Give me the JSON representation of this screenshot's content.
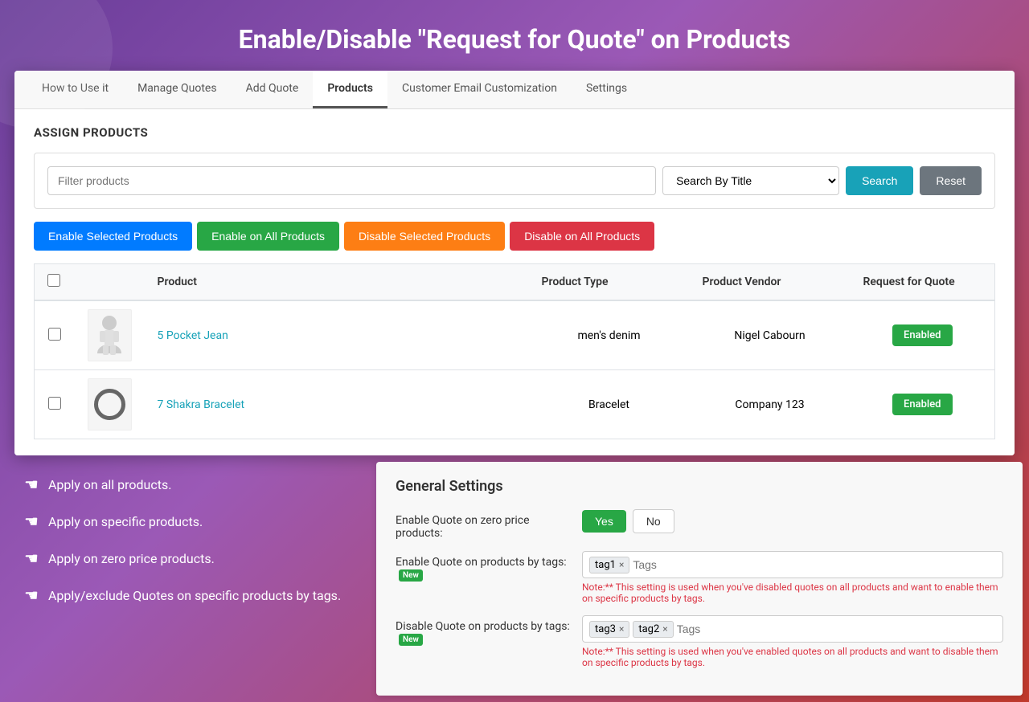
{
  "page": {
    "title": "Enable/Disable \"Request for Quote\" on Products",
    "background": "linear-gradient(135deg, #6a3d9a 0%, #9b59b6 40%, #c0392b 100%)"
  },
  "tabs": [
    {
      "label": "How to Use it",
      "active": false
    },
    {
      "label": "Manage Quotes",
      "active": false
    },
    {
      "label": "Add Quote",
      "active": false
    },
    {
      "label": "Products",
      "active": true
    },
    {
      "label": "Customer Email Customization",
      "active": false
    },
    {
      "label": "Settings",
      "active": false
    }
  ],
  "section": {
    "title": "ASSIGN PRODUCTS"
  },
  "filter": {
    "placeholder": "Filter products",
    "select_default": "Search By Title",
    "search_label": "Search",
    "reset_label": "Reset"
  },
  "action_buttons": {
    "enable_selected": "Enable Selected Products",
    "enable_all": "Enable on All Products",
    "disable_selected": "Disable Selected Products",
    "disable_all": "Disable on All Products"
  },
  "table": {
    "headers": [
      "",
      "",
      "Product",
      "Product Type",
      "Product Vendor",
      "Request for Quote"
    ],
    "rows": [
      {
        "id": 1,
        "product_name": "5 Pocket Jean",
        "product_type": "men's denim",
        "vendor": "Nigel Cabourn",
        "rfq_status": "Enabled",
        "img_type": "person"
      },
      {
        "id": 2,
        "product_name": "7 Shakra Bracelet",
        "product_type": "Bracelet",
        "vendor": "Company 123",
        "rfq_status": "Enabled",
        "img_type": "bracelet"
      }
    ]
  },
  "left_panel": {
    "items": [
      "Apply on all products.",
      "Apply on specific products.",
      "Apply on zero price products.",
      "Apply/exclude Quotes on specific products by tags."
    ]
  },
  "general_settings": {
    "title": "General Settings",
    "zero_price_label": "Enable Quote on zero price products:",
    "zero_price_yes": "Yes",
    "zero_price_no": "No",
    "tags_enable_label": "Enable Quote on products by tags:",
    "tags_enable_new": "New",
    "tags_enable_chips": [
      "tag1"
    ],
    "tags_enable_placeholder": "Tags",
    "tags_enable_note": "Note:** This setting is used when you've disabled quotes on all products and want to enable them on specific products by tags.",
    "tags_disable_label": "Disable Quote on products by tags:",
    "tags_disable_new": "New",
    "tags_disable_chips": [
      "tag3",
      "tag2"
    ],
    "tags_disable_placeholder": "Tags",
    "tags_disable_note": "Note:** This setting is used when you've enabled quotes on all products and want to disable them on specific products by tags."
  }
}
